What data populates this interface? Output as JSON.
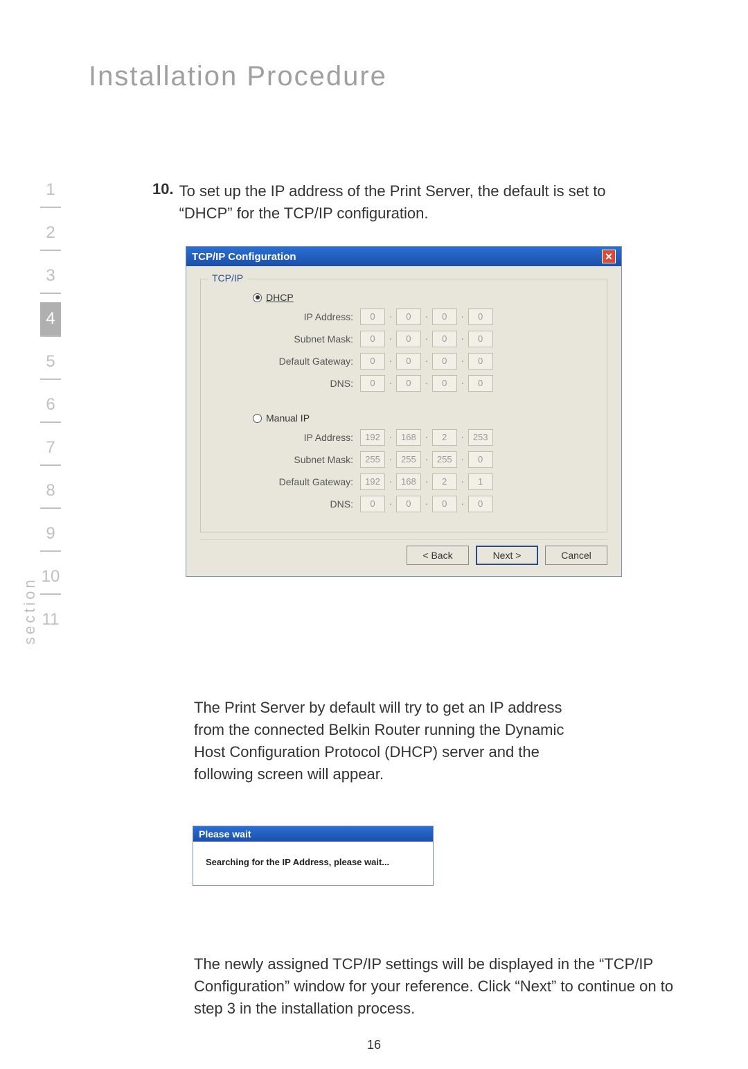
{
  "page": {
    "title": "Installation Procedure",
    "section_label": "section",
    "numbers": [
      "1",
      "2",
      "3",
      "4",
      "5",
      "6",
      "7",
      "8",
      "9",
      "10",
      "11"
    ],
    "active_index": 3,
    "page_number": "16"
  },
  "step": {
    "number": "10.",
    "text": "To set up the IP address of the Print Server, the default is set to “DHCP” for the TCP/IP configuration."
  },
  "dialog1": {
    "title": "TCP/IP Configuration",
    "close": "✕",
    "legend": "TCP/IP",
    "dhcp_label": "DHCP",
    "manual_label": "Manual IP",
    "labels": {
      "ip": "IP Address:",
      "subnet": "Subnet Mask:",
      "gateway": "Default Gateway:",
      "dns": "DNS:"
    },
    "dhcp": {
      "ip": [
        "0",
        "0",
        "0",
        "0"
      ],
      "subnet": [
        "0",
        "0",
        "0",
        "0"
      ],
      "gateway": [
        "0",
        "0",
        "0",
        "0"
      ],
      "dns": [
        "0",
        "0",
        "0",
        "0"
      ]
    },
    "manual": {
      "ip": [
        "192",
        "168",
        "2",
        "253"
      ],
      "subnet": [
        "255",
        "255",
        "255",
        "0"
      ],
      "gateway": [
        "192",
        "168",
        "2",
        "1"
      ],
      "dns": [
        "0",
        "0",
        "0",
        "0"
      ]
    },
    "buttons": {
      "back": "< Back",
      "next": "Next >",
      "cancel": "Cancel"
    }
  },
  "para2": "The Print Server by default will try to get an IP address from the connected Belkin Router running the Dynamic Host Configuration Protocol (DHCP) server and the following screen will appear.",
  "dialog2": {
    "title": "Please wait",
    "body": "Searching for the IP Address, please wait..."
  },
  "para3": "The newly assigned TCP/IP settings will be displayed in the “TCP/IP Configuration” window for your reference. Click “Next” to continue on to step 3 in the installation process."
}
